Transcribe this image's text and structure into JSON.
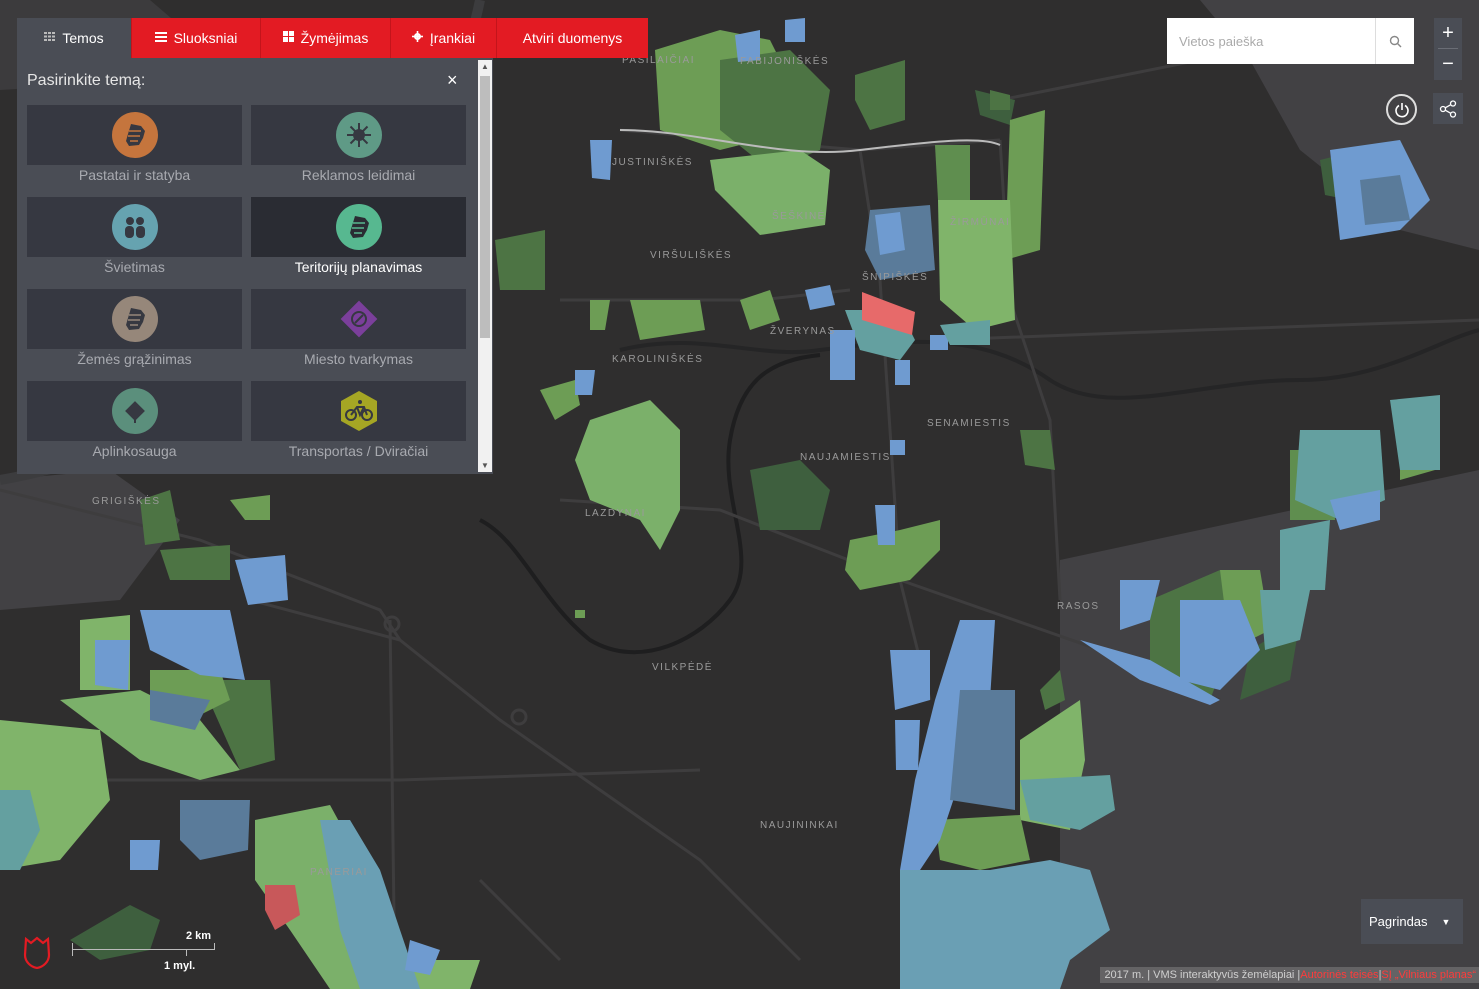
{
  "tabs": [
    {
      "label": "Temos",
      "icon": "grid-icon",
      "active": true
    },
    {
      "label": "Sluoksniai",
      "icon": "layers-icon"
    },
    {
      "label": "Žymėjimas",
      "icon": "marking-icon"
    },
    {
      "label": "Įrankiai",
      "icon": "gear-icon"
    },
    {
      "label": "Atviri duomenys",
      "icon": ""
    }
  ],
  "panel": {
    "title": "Pasirinkite temą:",
    "close": "×",
    "themes": [
      {
        "label": "Pastatai ir statyba",
        "color": "#c5753d",
        "icon": "building-icon"
      },
      {
        "label": "Reklamos leidimai",
        "color": "#5f9a86",
        "icon": "sunburst-icon"
      },
      {
        "label": "Švietimas",
        "color": "#66a3b0",
        "icon": "people-icon"
      },
      {
        "label": "Teritorijų planavimas",
        "color": "#57b890",
        "icon": "territory-icon",
        "selected": true
      },
      {
        "label": "Žemės grąžinimas",
        "color": "#96877a",
        "icon": "land-icon"
      },
      {
        "label": "Miesto tvarkymas",
        "color": "#7b3f9b",
        "icon": "city-care-icon"
      },
      {
        "label": "Aplinkosauga",
        "color": "#5b8f7c",
        "icon": "leaf-icon"
      },
      {
        "label": "Transportas / Dviračiai",
        "color": "#a5a624",
        "icon": "bicycle-icon"
      }
    ]
  },
  "search": {
    "placeholder": "Vietos paieška"
  },
  "zoom": {
    "in": "+",
    "out": "−"
  },
  "basemap": {
    "label": "Pagrindas"
  },
  "attribution": {
    "text": "2017 m. | VMS interaktyvūs žemėlapiai | ",
    "link1": "Autorinės teisės",
    "sep": " | ",
    "link2": "SĮ „Vilniaus planas“"
  },
  "scale": {
    "km": "2 km",
    "mi": "1 myl."
  },
  "map_labels": [
    {
      "text": "PAŠILAIČIAI"
    },
    {
      "text": "FABIJONIŠKĖS"
    },
    {
      "text": "JUSTINIŠKĖS"
    },
    {
      "text": "ŠEŠKINĖ"
    },
    {
      "text": "ŽIRMŪNAI"
    },
    {
      "text": "VIRŠULIŠKĖS"
    },
    {
      "text": "ŠNIPIŠKĖS"
    },
    {
      "text": "ŽVERYNAS"
    },
    {
      "text": "KAROLINIŠKĖS"
    },
    {
      "text": "SENAMIESTIS"
    },
    {
      "text": "NAUJAMIESTIS"
    },
    {
      "text": "LAZDYNAI"
    },
    {
      "text": "GRIGIŠKĖS"
    },
    {
      "text": "RASOS"
    },
    {
      "text": "VILKPĖDĖ"
    },
    {
      "text": "NAUJININKAI"
    },
    {
      "text": "PANERIAI"
    }
  ]
}
